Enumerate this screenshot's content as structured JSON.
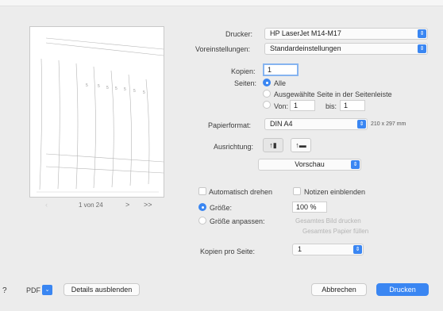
{
  "dialog": {
    "printer_label": "Drucker:",
    "printer_value": "HP LaserJet M14-M17",
    "presets_label": "Voreinstellungen:",
    "presets_value": "Standardeinstellungen",
    "copies_label": "Kopien:",
    "copies_value": "1",
    "pages_label": "Seiten:",
    "pages_all": "Alle",
    "pages_selected": "Ausgewählte Seite in der Seitenleiste",
    "pages_from_label": "Von:",
    "pages_from_value": "1",
    "pages_to_label": "bis:",
    "pages_to_value": "1",
    "paper_label": "Papierformat:",
    "paper_value": "DIN A4",
    "paper_size": "210 x 297 mm",
    "orientation_label": "Ausrichtung:",
    "section_popup": "Vorschau",
    "auto_rotate": "Automatisch drehen",
    "show_notes": "Notizen einblenden",
    "size_label": "Größe:",
    "size_value": "100 %",
    "fit_label": "Größe anpassen:",
    "fit_option_1": "Gesamtes Bild drucken",
    "fit_option_2": "Gesamtes Papier füllen",
    "pages_per_sheet_label": "Kopien pro Seite:",
    "pages_per_sheet_value": "1"
  },
  "preview": {
    "page_indicator": "1 von 24",
    "next": ">",
    "last": ">>"
  },
  "footer": {
    "help": "?",
    "pdf": "PDF",
    "details": "Details ausblenden",
    "cancel": "Abbrechen",
    "print": "Drucken"
  },
  "icons": {
    "popup_arrow": "updown-chevron-icon",
    "portrait": "portrait-orientation-icon",
    "landscape": "landscape-orientation-icon"
  },
  "colors": {
    "accent": "#3a86f2",
    "background": "#ececec"
  }
}
